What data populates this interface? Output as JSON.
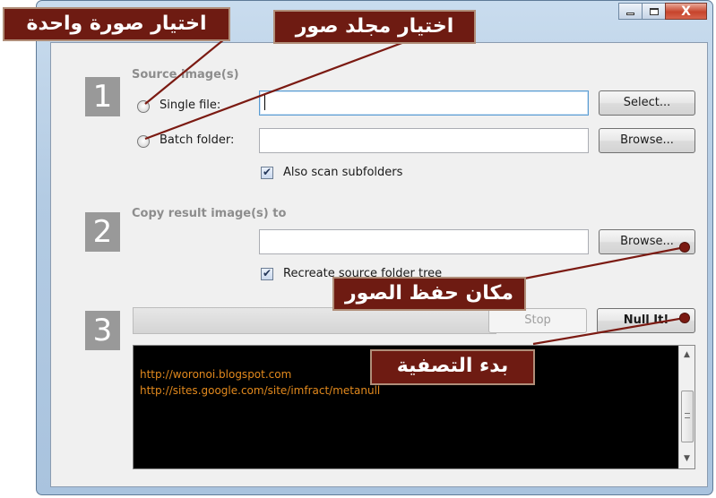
{
  "window": {
    "controls": [
      "minimize-icon",
      "maximize-icon",
      "close-icon"
    ],
    "close_glyph": "X"
  },
  "section1": {
    "number": "1",
    "title": "Source image(s)",
    "single_file_label": "Single file:",
    "single_file_value": "",
    "select_button": "Select...",
    "batch_folder_label": "Batch folder:",
    "batch_folder_value": "",
    "browse_button": "Browse...",
    "scan_subfolders_label": "Also scan subfolders",
    "scan_subfolders_checked": true
  },
  "section2": {
    "number": "2",
    "title": "Copy result image(s) to",
    "destination_value": "",
    "browse_button": "Browse...",
    "recreate_tree_label": "Recreate source folder tree",
    "recreate_tree_checked": true
  },
  "section3": {
    "number": "3",
    "progress": 0,
    "stop_button": "Stop",
    "stop_enabled": false,
    "null_it_button": "Null It!"
  },
  "console": {
    "lines": [
      "http://woronoi.blogspot.com",
      "http://sites.google.com/site/imfract/metanull"
    ]
  },
  "callouts": {
    "choose_image": "اختيار صورة واحدة",
    "choose_folder": "اختيار مجلد صور",
    "save_location": "مكان حفظ الصور",
    "start_cleanup": "بدء التصفية"
  },
  "colors": {
    "callout_bg": "#6e1b12",
    "console_text": "#e2891d",
    "step_box": "#999999"
  }
}
